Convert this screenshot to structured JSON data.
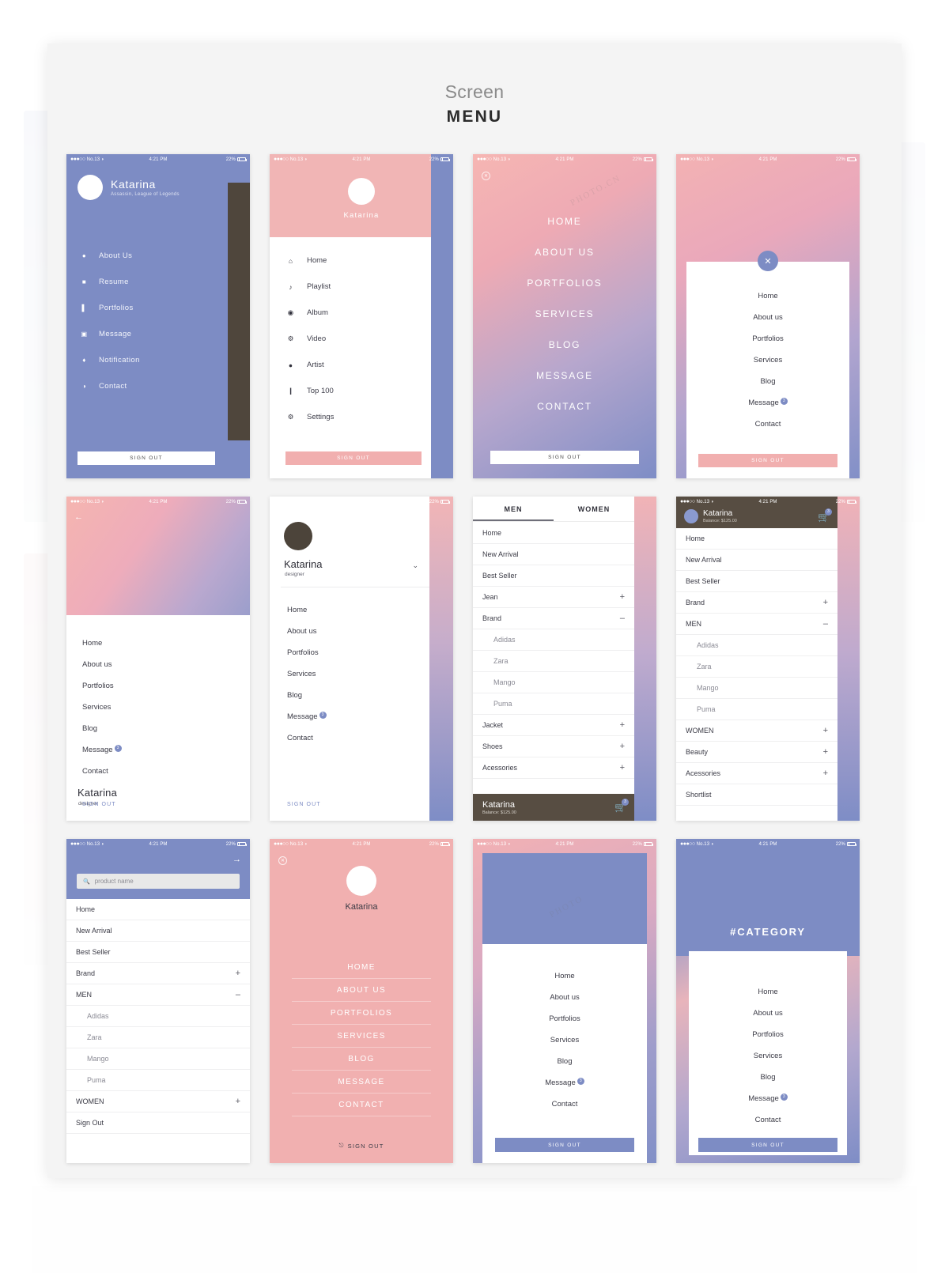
{
  "header": {
    "eyebrow": "Screen",
    "title": "MENU"
  },
  "status_bar": {
    "carrier": "No.13",
    "time": "4:21 PM",
    "battery": "22%"
  },
  "common": {
    "sign_out": "SIGN OUT",
    "sign_out_title": "Sign Out",
    "badge_count": "3",
    "user_name": "Katarina",
    "user_role": "designer",
    "balance": "Balance: $125.00"
  },
  "colors": {
    "blue": "#7d8cc4",
    "pink": "#f1b0b0",
    "dark": "#574d42",
    "text": "#3b3b46"
  },
  "screens": {
    "s1": {
      "name": "Katarina",
      "subtitle": "Assassin, League of Legends",
      "items": [
        {
          "icon": "person-icon",
          "glyph": "●",
          "label": "About Us"
        },
        {
          "icon": "briefcase-icon",
          "glyph": "■",
          "label": "Resume"
        },
        {
          "icon": "book-icon",
          "glyph": "▌",
          "label": "Portfolios"
        },
        {
          "icon": "chat-icon",
          "glyph": "▣",
          "label": "Message"
        },
        {
          "icon": "bell-icon",
          "glyph": "♦",
          "label": "Notification"
        },
        {
          "icon": "phone-icon",
          "glyph": "◑",
          "label": "Contact"
        }
      ],
      "sign_out": "SIGN OUT"
    },
    "s2": {
      "name": "Katarina",
      "items": [
        {
          "icon": "home-icon",
          "glyph": "⌂",
          "label": "Home"
        },
        {
          "icon": "music-note-icon",
          "glyph": "♪",
          "label": "Playlist"
        },
        {
          "icon": "disc-icon",
          "glyph": "◉",
          "label": "Album"
        },
        {
          "icon": "video-icon",
          "glyph": "⚙",
          "label": "Video"
        },
        {
          "icon": "artist-icon",
          "glyph": "●",
          "label": "Artist"
        },
        {
          "icon": "mic-icon",
          "glyph": "❙",
          "label": "Top 100"
        },
        {
          "icon": "gear-icon",
          "glyph": "⚙",
          "label": "Settings"
        }
      ],
      "sign_out": "SIGN OUT"
    },
    "s3": {
      "items": [
        "HOME",
        "ABOUT US",
        "PORTFOLIOS",
        "SERVICES",
        "BLOG",
        "MESSAGE",
        "CONTACT"
      ],
      "sign_out": "SIGN OUT"
    },
    "s4": {
      "items": [
        {
          "label": "Home",
          "badge": ""
        },
        {
          "label": "About us",
          "badge": ""
        },
        {
          "label": "Portfolios",
          "badge": ""
        },
        {
          "label": "Services",
          "badge": ""
        },
        {
          "label": "Blog",
          "badge": ""
        },
        {
          "label": "Message",
          "badge": "3"
        },
        {
          "label": "Contact",
          "badge": ""
        }
      ],
      "sign_out": "SIGN OUT"
    },
    "s5": {
      "name": "Katarina",
      "role": "designer",
      "items": [
        {
          "label": "Home",
          "badge": ""
        },
        {
          "label": "About us",
          "badge": ""
        },
        {
          "label": "Portfolios",
          "badge": ""
        },
        {
          "label": "Services",
          "badge": ""
        },
        {
          "label": "Blog",
          "badge": ""
        },
        {
          "label": "Message",
          "badge": "3"
        },
        {
          "label": "Contact",
          "badge": ""
        }
      ],
      "sign_out": "SIGN OUT"
    },
    "s6": {
      "name": "Katarina",
      "role": "designer",
      "items": [
        {
          "label": "Home",
          "badge": ""
        },
        {
          "label": "About us",
          "badge": ""
        },
        {
          "label": "Portfolios",
          "badge": ""
        },
        {
          "label": "Services",
          "badge": ""
        },
        {
          "label": "Blog",
          "badge": ""
        },
        {
          "label": "Message",
          "badge": "3"
        },
        {
          "label": "Contact",
          "badge": ""
        }
      ],
      "sign_out": "SIGN OUT"
    },
    "s7": {
      "tabs": [
        {
          "label": "MEN",
          "active": true
        },
        {
          "label": "WOMEN",
          "active": false
        }
      ],
      "rows": [
        {
          "label": "Home",
          "control": "",
          "sub": false
        },
        {
          "label": "New Arrival",
          "control": "",
          "sub": false
        },
        {
          "label": "Best Seller",
          "control": "",
          "sub": false
        },
        {
          "label": "Jean",
          "control": "+",
          "sub": false
        },
        {
          "label": "Brand",
          "control": "–",
          "sub": false
        },
        {
          "label": "Adidas",
          "control": "",
          "sub": true
        },
        {
          "label": "Zara",
          "control": "",
          "sub": true
        },
        {
          "label": "Mango",
          "control": "",
          "sub": true
        },
        {
          "label": "Puma",
          "control": "",
          "sub": true
        },
        {
          "label": "Jacket",
          "control": "+",
          "sub": false
        },
        {
          "label": "Shoes",
          "control": "+",
          "sub": false
        },
        {
          "label": "Acessories",
          "control": "+",
          "sub": false
        }
      ],
      "footer_name": "Katarina",
      "footer_balance": "Balance: $125.00",
      "cart_badge": "3"
    },
    "s8": {
      "name": "Katarina",
      "balance": "Balance: $125.00",
      "cart_badge": "3",
      "rows": [
        {
          "label": "Home",
          "control": "",
          "sub": false
        },
        {
          "label": "New Arrival",
          "control": "",
          "sub": false
        },
        {
          "label": "Best Seller",
          "control": "",
          "sub": false
        },
        {
          "label": "Brand",
          "control": "+",
          "sub": false
        },
        {
          "label": "MEN",
          "control": "–",
          "sub": false
        },
        {
          "label": "Adidas",
          "control": "",
          "sub": true
        },
        {
          "label": "Zara",
          "control": "",
          "sub": true
        },
        {
          "label": "Mango",
          "control": "",
          "sub": true
        },
        {
          "label": "Puma",
          "control": "",
          "sub": true
        },
        {
          "label": "WOMEN",
          "control": "+",
          "sub": false
        },
        {
          "label": "Beauty",
          "control": "+",
          "sub": false
        },
        {
          "label": "Acessories",
          "control": "+",
          "sub": false
        },
        {
          "label": "Shortlist",
          "control": "",
          "sub": false
        }
      ]
    },
    "s9": {
      "search_placeholder": "product name",
      "rows": [
        {
          "label": "Home",
          "control": "",
          "sub": false
        },
        {
          "label": "New Arrival",
          "control": "",
          "sub": false
        },
        {
          "label": "Best Seller",
          "control": "",
          "sub": false
        },
        {
          "label": "Brand",
          "control": "+",
          "sub": false
        },
        {
          "label": "MEN",
          "control": "–",
          "sub": false
        },
        {
          "label": "Adidas",
          "control": "",
          "sub": true
        },
        {
          "label": "Zara",
          "control": "",
          "sub": true
        },
        {
          "label": "Mango",
          "control": "",
          "sub": true
        },
        {
          "label": "Puma",
          "control": "",
          "sub": true
        },
        {
          "label": "WOMEN",
          "control": "+",
          "sub": false
        },
        {
          "label": "Sign Out",
          "control": "",
          "sub": false
        }
      ]
    },
    "s10": {
      "name": "Katarina",
      "items": [
        "HOME",
        "ABOUT US",
        "PORTFOLIOS",
        "SERVICES",
        "BLOG",
        "MESSAGE",
        "CONTACT"
      ],
      "sign_out": "SIGN OUT"
    },
    "s11": {
      "items": [
        {
          "label": "Home",
          "badge": ""
        },
        {
          "label": "About us",
          "badge": ""
        },
        {
          "label": "Portfolios",
          "badge": ""
        },
        {
          "label": "Services",
          "badge": ""
        },
        {
          "label": "Blog",
          "badge": ""
        },
        {
          "label": "Message",
          "badge": "3"
        },
        {
          "label": "Contact",
          "badge": ""
        }
      ],
      "sign_out": "SIGN OUT"
    },
    "s12": {
      "title": "#CATEGORY",
      "items": [
        {
          "label": "Home",
          "badge": ""
        },
        {
          "label": "About us",
          "badge": ""
        },
        {
          "label": "Portfolios",
          "badge": ""
        },
        {
          "label": "Services",
          "badge": ""
        },
        {
          "label": "Blog",
          "badge": ""
        },
        {
          "label": "Message",
          "badge": "3"
        },
        {
          "label": "Contact",
          "badge": ""
        }
      ],
      "sign_out": "SIGN OUT"
    }
  }
}
